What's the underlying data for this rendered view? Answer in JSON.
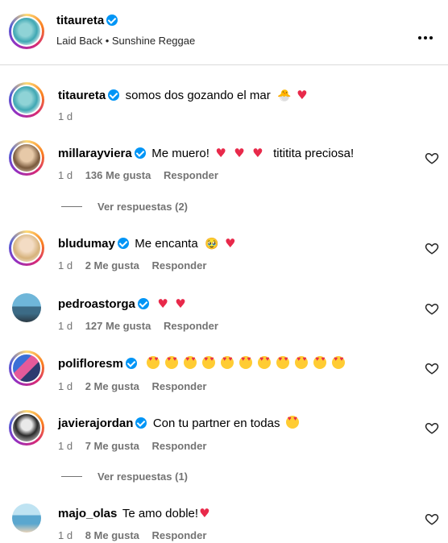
{
  "header": {
    "username": "titaureta",
    "song": "Laid Back • Sunshine Reggae"
  },
  "caption": {
    "username": "titaureta",
    "text": "somos dos gozando el mar",
    "time": "1 d"
  },
  "comments": [
    {
      "username": "millarayviera",
      "text": "Me muero!",
      "text2": "tititita preciosa!",
      "time": "1 d",
      "likes": "136 Me gusta",
      "reply": "Responder",
      "view_replies": "Ver respuestas (2)"
    },
    {
      "username": "bludumay",
      "text": "Me encanta",
      "time": "1 d",
      "likes": "2 Me gusta",
      "reply": "Responder"
    },
    {
      "username": "pedroastorga",
      "text": "",
      "time": "1 d",
      "likes": "127 Me gusta",
      "reply": "Responder"
    },
    {
      "username": "polifloresm",
      "text": "",
      "time": "1 d",
      "likes": "2 Me gusta",
      "reply": "Responder"
    },
    {
      "username": "javierajordan",
      "text": "Con tu partner en todas",
      "time": "1 d",
      "likes": "7 Me gusta",
      "reply": "Responder",
      "view_replies": "Ver respuestas (1)"
    },
    {
      "username": "majo_olas",
      "text": "Te amo doble!",
      "time": "1 d",
      "likes": "8 Me gusta",
      "reply": "Responder"
    }
  ],
  "icons": {
    "verified": "verified-badge-icon",
    "more": "more-options-icon",
    "like": "heart-outline-icon"
  },
  "colors": {
    "verified": "#0095f6",
    "meta_text": "#737373",
    "heart": "#e8294a"
  }
}
